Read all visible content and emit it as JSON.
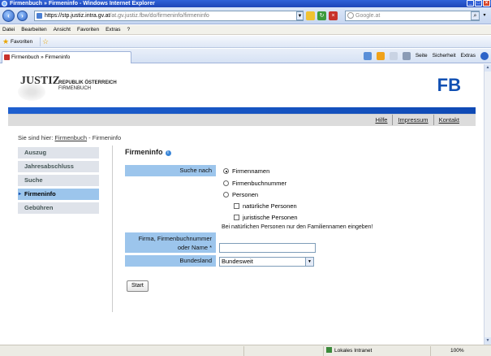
{
  "window": {
    "title": "Firmenbuch » Firmeninfo - Windows Internet Explorer",
    "controls": [
      "_",
      "□",
      "×"
    ]
  },
  "addressbar": {
    "url_main": "https://stp.justiz.intra.gv.at",
    "url_rest": "/at.gv.justiz.fbw/do/firmeninfo/firmeninfo",
    "search_placeholder": "Google.at"
  },
  "menubar": [
    "Datei",
    "Bearbeiten",
    "Ansicht",
    "Favoriten",
    "Extras",
    "?"
  ],
  "favbar": {
    "label": "Favoriten"
  },
  "tab": {
    "label": "Firmenbuch » Firmeninfo"
  },
  "commandbar": {
    "seite": "Seite",
    "sicherheit": "Sicherheit",
    "extras": "Extras"
  },
  "site": {
    "logo_text": "JUSTIZ",
    "republic": "REPUBLIK ÖSTERREICH",
    "firmenbuch": "FIRMENBUCH",
    "fb_mark": "FB",
    "toplinks": [
      "Hilfe",
      "Impressum",
      "Kontakt"
    ],
    "breadcrumb": {
      "prefix": "Sie sind hier:",
      "link": "Firmenbuch",
      "sep": " - ",
      "current": "Firmeninfo"
    },
    "nav": [
      "Auszug",
      "Jahresabschluss",
      "Suche",
      "Firmeninfo",
      "Gebühren"
    ],
    "active_nav": 3
  },
  "form": {
    "heading": "Firmeninfo",
    "search_by_label": "Suche nach",
    "options": {
      "firmennamen": "Firmennamen",
      "firmenbuchnummer": "Firmenbuchnummer",
      "personen": "Personen",
      "natuerliche": "natürliche Personen",
      "juristische": "juristische Personen"
    },
    "selected_option": "Firmennamen",
    "hint": "Bei natürlichen Personen nur den Familiennamen eingeben!",
    "name_label_1": "Firma, Firmenbuchnummer",
    "name_label_2": "oder Name *",
    "name_value": "",
    "bundesland_label": "Bundesland",
    "bundesland_value": "Bundesweit",
    "start_button": "Start"
  },
  "statusbar": {
    "zone": "Lokales Intranet",
    "zoom": "100%"
  },
  "colors": {
    "accent_blue": "#1150b3",
    "label_bg": "#9cc5ec",
    "nav_bg": "#dfe3ea"
  }
}
